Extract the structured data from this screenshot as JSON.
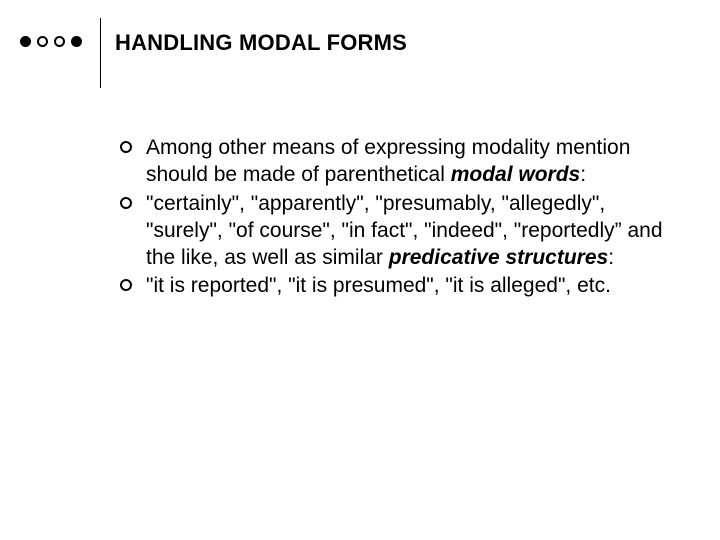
{
  "title": "HANDLING MODAL FORMS",
  "items": [
    {
      "runs": [
        {
          "t": "Among other means of expressing modality mention should be made of parenthetical "
        },
        {
          "t": "modal words",
          "bi": true
        },
        {
          "t": ":"
        }
      ]
    },
    {
      "runs": [
        {
          "t": "\"certainly\", \"apparently\", \"presumably, \"allegedly\", \"surely\", \"of course\", \"in fact\", \"indeed\", \"reportedly” and the like, as well as similar "
        },
        {
          "t": "predicative structures",
          "bi": true
        },
        {
          "t": ":"
        }
      ]
    },
    {
      "runs": [
        {
          "t": "\"it is reported\", \"it is presumed\", \"it is alleged\", etc."
        }
      ]
    }
  ]
}
